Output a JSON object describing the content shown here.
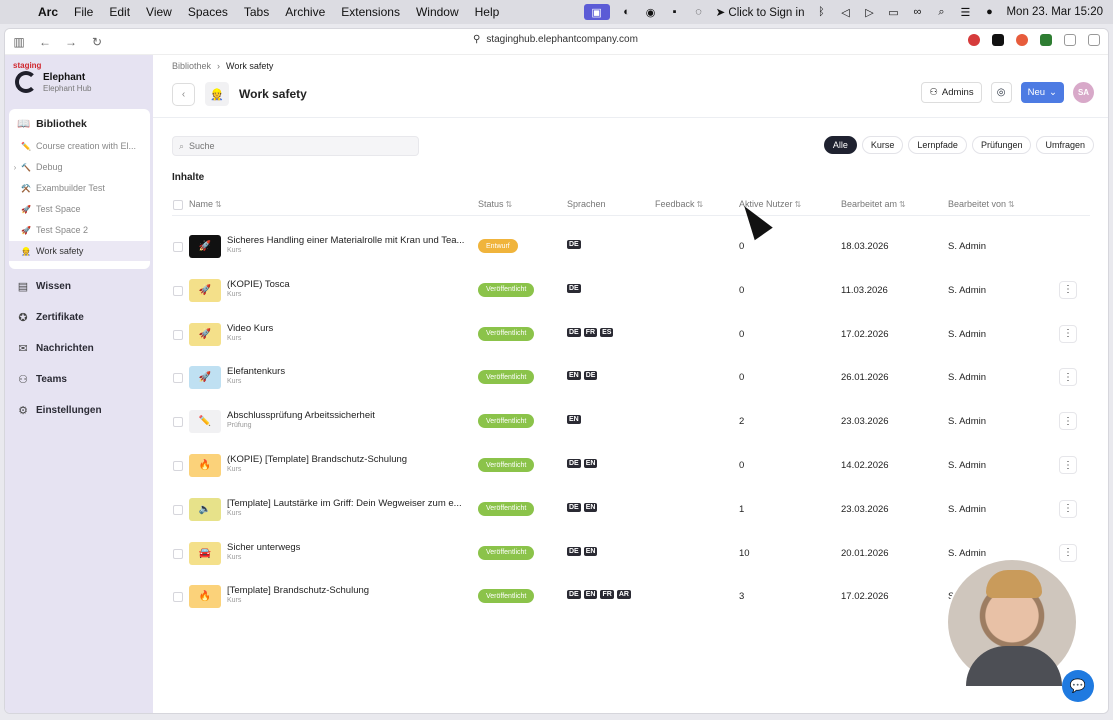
{
  "menubar": {
    "app": "Arc",
    "items": [
      "File",
      "Edit",
      "View",
      "Spaces",
      "Tabs",
      "Archive",
      "Extensions",
      "Window",
      "Help"
    ],
    "sign_in": "Click to Sign in",
    "datetime": "Mon 23. Mar  15:20"
  },
  "browser": {
    "url": "staginghub.elephantcompany.com"
  },
  "brand": {
    "badge": "staging",
    "name": "Elephant",
    "sub": "Elephant Hub"
  },
  "sidebar": {
    "library_label": "Bibliothek",
    "library_items": [
      {
        "emoji": "✏️",
        "label": "Course creation with El..."
      },
      {
        "emoji": "🔨",
        "label": "Debug",
        "expandable": true
      },
      {
        "emoji": "⚒️",
        "label": "Exambuilder Test"
      },
      {
        "emoji": "🚀",
        "label": "Test Space"
      },
      {
        "emoji": "🚀",
        "label": "Test Space 2"
      },
      {
        "emoji": "👷",
        "label": "Work safety",
        "active": true
      }
    ],
    "nav": [
      {
        "icon": "book-icon",
        "label": "Wissen"
      },
      {
        "icon": "certificate-icon",
        "label": "Zertifikate"
      },
      {
        "icon": "message-icon",
        "label": "Nachrichten"
      },
      {
        "icon": "team-icon",
        "label": "Teams"
      },
      {
        "icon": "gear-icon",
        "label": "Einstellungen"
      }
    ]
  },
  "breadcrumb": {
    "parent": "Bibliothek",
    "current": "Work safety"
  },
  "page": {
    "icon": "👷",
    "title": "Work safety"
  },
  "header_buttons": {
    "admins": "Admins",
    "new": "Neu",
    "avatar": "SA"
  },
  "search": {
    "placeholder": "Suche"
  },
  "filters": [
    "Alle",
    "Kurse",
    "Lernpfade",
    "Prüfungen",
    "Umfragen"
  ],
  "section_title": "Inhalte",
  "columns": {
    "name": "Name",
    "status": "Status",
    "languages": "Sprachen",
    "feedback": "Feedback",
    "active_users": "Aktive Nutzer",
    "edited_on": "Bearbeitet am",
    "edited_by": "Bearbeitet von"
  },
  "colors": {
    "draft": "#f0b43c",
    "published": "#8bc34a",
    "accent": "#4d7be3"
  },
  "rows": [
    {
      "title": "Sicheres Handling einer Materialrolle mit Kran und Tea...",
      "type": "Kurs",
      "status": "Entwurf",
      "status_kind": "draft",
      "langs": [
        "DE"
      ],
      "users": "0",
      "date": "18.03.2026",
      "by": "S. Admin",
      "thumb": "🚀",
      "thumb_bg": "#111111",
      "has_menu": false
    },
    {
      "title": "(KOPIE) Tosca",
      "type": "Kurs",
      "status": "Veröffentlicht",
      "status_kind": "published",
      "langs": [
        "DE"
      ],
      "users": "0",
      "date": "11.03.2026",
      "by": "S. Admin",
      "thumb": "🚀",
      "thumb_bg": "#f4e08a",
      "has_menu": true
    },
    {
      "title": "Video Kurs",
      "type": "Kurs",
      "status": "Veröffentlicht",
      "status_kind": "published",
      "langs": [
        "DE",
        "FR",
        "ES"
      ],
      "users": "0",
      "date": "17.02.2026",
      "by": "S. Admin",
      "thumb": "🚀",
      "thumb_bg": "#f4e08a",
      "has_menu": true
    },
    {
      "title": "Elefantenkurs",
      "type": "Kurs",
      "status": "Veröffentlicht",
      "status_kind": "published",
      "langs": [
        "EN",
        "DE"
      ],
      "users": "0",
      "date": "26.01.2026",
      "by": "S. Admin",
      "thumb": "🚀",
      "thumb_bg": "#bfe0f2",
      "has_menu": true
    },
    {
      "title": "Abschlussprüfung Arbeitssicherheit",
      "type": "Prüfung",
      "status": "Veröffentlicht",
      "status_kind": "published",
      "langs": [
        "EN"
      ],
      "users": "2",
      "date": "23.03.2026",
      "by": "S. Admin",
      "thumb": "✏️",
      "thumb_bg": "#f1f1f3",
      "has_menu": true
    },
    {
      "title": "(KOPIE) [Template] Brandschutz-Schulung",
      "type": "Kurs",
      "status": "Veröffentlicht",
      "status_kind": "published",
      "langs": [
        "DE",
        "EN"
      ],
      "users": "0",
      "date": "14.02.2026",
      "by": "S. Admin",
      "thumb": "🔥",
      "thumb_bg": "#fbd27a",
      "has_menu": true
    },
    {
      "title": "[Template] Lautstärke im Griff: Dein Wegweiser zum e...",
      "type": "Kurs",
      "status": "Veröffentlicht",
      "status_kind": "published",
      "langs": [
        "DE",
        "EN"
      ],
      "users": "1",
      "date": "23.03.2026",
      "by": "S. Admin",
      "thumb": "🔈",
      "thumb_bg": "#e7e28a",
      "has_menu": true
    },
    {
      "title": "Sicher unterwegs",
      "type": "Kurs",
      "status": "Veröffentlicht",
      "status_kind": "published",
      "langs": [
        "DE",
        "EN"
      ],
      "users": "10",
      "date": "20.01.2026",
      "by": "S. Admin",
      "thumb": "🚘",
      "thumb_bg": "#f4e08a",
      "has_menu": true
    },
    {
      "title": "[Template] Brandschutz-Schulung",
      "type": "Kurs",
      "status": "Veröffentlicht",
      "status_kind": "published",
      "langs": [
        "DE",
        "EN",
        "FR",
        "AR"
      ],
      "users": "3",
      "date": "17.02.2026",
      "by": "S.",
      "thumb": "🔥",
      "thumb_bg": "#fbd27a",
      "has_menu": false
    }
  ]
}
